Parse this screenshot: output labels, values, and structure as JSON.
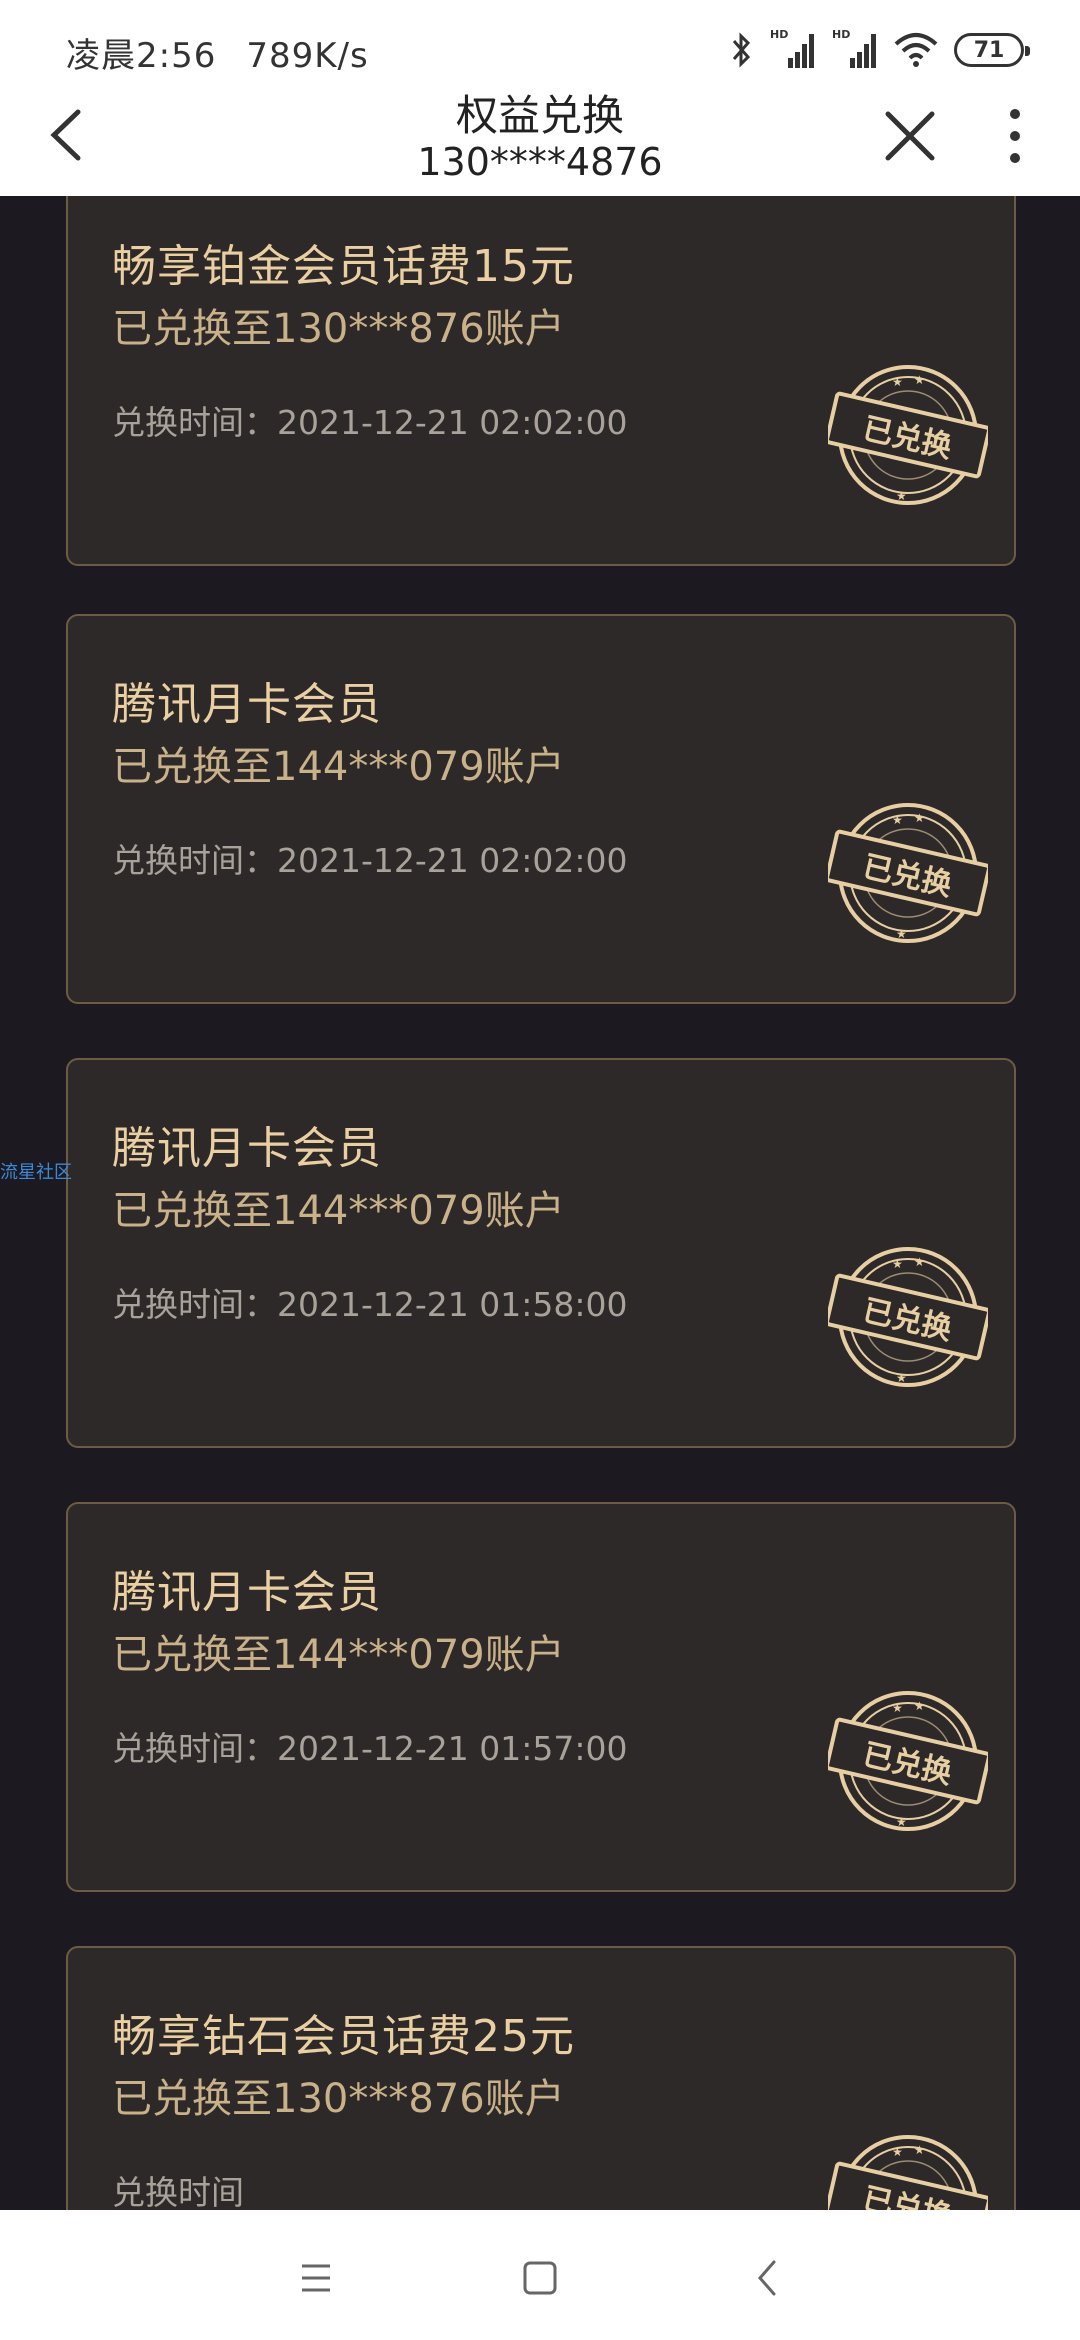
{
  "status_bar": {
    "time": "凌晨2:56",
    "speed": "789K/s",
    "hd1": "HD",
    "hd2": "HD",
    "battery": "71",
    "icons": [
      "bluetooth-icon",
      "signal-icon",
      "signal-icon",
      "wifi-icon",
      "battery-icon"
    ]
  },
  "nav": {
    "title": "权益兑换",
    "subtitle": "130****4876",
    "icons": [
      "back-icon",
      "close-icon",
      "more-icon"
    ]
  },
  "watermark": "流星社区",
  "cards": [
    {
      "title": "畅享铂金会员话费15元",
      "account": "已兑换至130***876账户",
      "time": "兑换时间：2021-12-21 02:02:00",
      "stamp": "已兑换"
    },
    {
      "title": "腾讯月卡会员",
      "account": "已兑换至144***079账户",
      "time": "兑换时间：2021-12-21 02:02:00",
      "stamp": "已兑换"
    },
    {
      "title": "腾讯月卡会员",
      "account": "已兑换至144***079账户",
      "time": "兑换时间：2021-12-21 01:58:00",
      "stamp": "已兑换"
    },
    {
      "title": "腾讯月卡会员",
      "account": "已兑换至144***079账户",
      "time": "兑换时间：2021-12-21 01:57:00",
      "stamp": "已兑换"
    },
    {
      "title": "畅享钻石会员话费25元",
      "account": "已兑换至130***876账户",
      "time": "兑换时间",
      "stamp": "已兑换"
    }
  ],
  "bottom_nav": {
    "icons": [
      "menu-icon",
      "home-icon",
      "back-icon"
    ]
  },
  "colors": {
    "background": "#1c1a20",
    "card": "#2c2928",
    "card_border": "#6e5b45",
    "title_gold": "#e9cfa1",
    "account_gold": "#c9b18a",
    "time_gray": "#a9a29a"
  }
}
